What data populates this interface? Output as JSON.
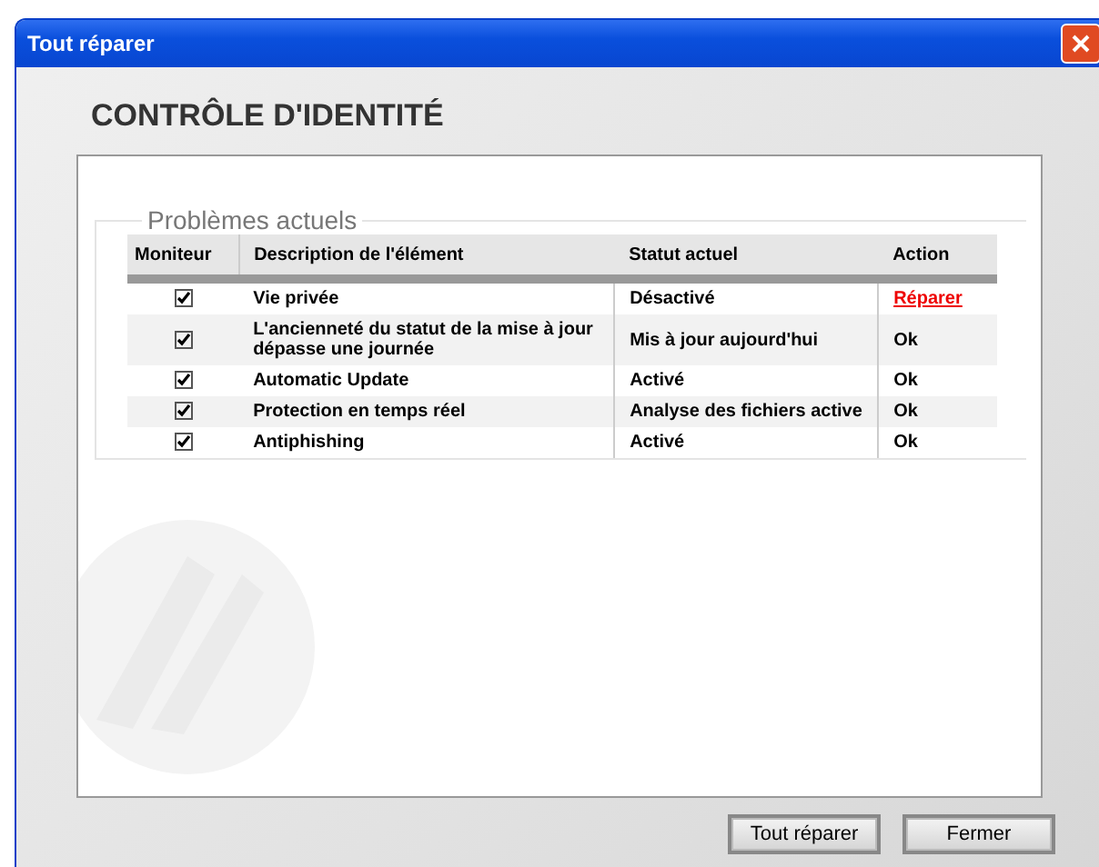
{
  "window": {
    "title": "Tout réparer"
  },
  "heading": "CONTRÔLE D'IDENTITÉ",
  "group": {
    "legend": "Problèmes actuels"
  },
  "table": {
    "columns": [
      "Moniteur",
      "Description de l'élément",
      "Statut actuel",
      "Action"
    ],
    "rows": [
      {
        "checked": true,
        "description": "Vie privée",
        "status": "Désactivé",
        "action": {
          "kind": "link",
          "text": "Réparer"
        }
      },
      {
        "checked": true,
        "description": "L'ancienneté du statut de la mise à jour dépasse une journée",
        "status": "Mis à jour aujourd'hui",
        "action": {
          "kind": "text",
          "text": "Ok"
        }
      },
      {
        "checked": true,
        "description": "Automatic Update",
        "status": "Activé",
        "action": {
          "kind": "text",
          "text": "Ok"
        }
      },
      {
        "checked": true,
        "description": "Protection en temps réel",
        "status": "Analyse des fichiers active",
        "action": {
          "kind": "text",
          "text": "Ok"
        }
      },
      {
        "checked": true,
        "description": "Antiphishing",
        "status": "Activé",
        "action": {
          "kind": "text",
          "text": "Ok"
        }
      }
    ]
  },
  "buttons": [
    "Tout réparer",
    "Fermer"
  ]
}
